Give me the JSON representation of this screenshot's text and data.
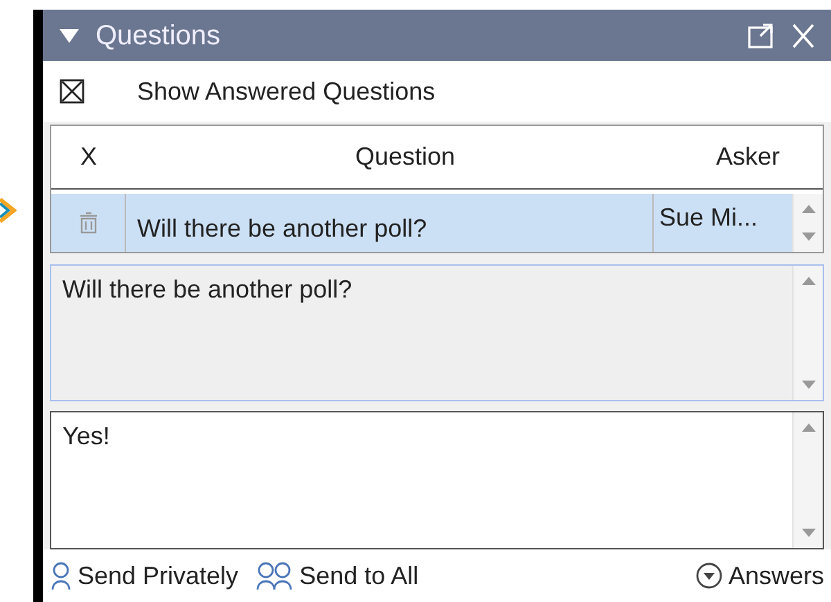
{
  "panel": {
    "title": "Questions"
  },
  "show_answered": {
    "label": "Show Answered Questions",
    "checked": true
  },
  "table": {
    "columns": [
      "X",
      "Question",
      "Asker"
    ],
    "rows": [
      {
        "question": "Will there be another poll?",
        "asker": "Sue Mi...",
        "selected": true
      }
    ]
  },
  "question_view": {
    "value": "Will there be another poll?"
  },
  "answer": {
    "value": "Yes!"
  },
  "toolbar": [
    {
      "kind": "single",
      "label": "Send Privately"
    },
    {
      "kind": "group",
      "label": "Send to All"
    },
    {
      "kind": "dropdown",
      "label": "Answers"
    }
  ]
}
